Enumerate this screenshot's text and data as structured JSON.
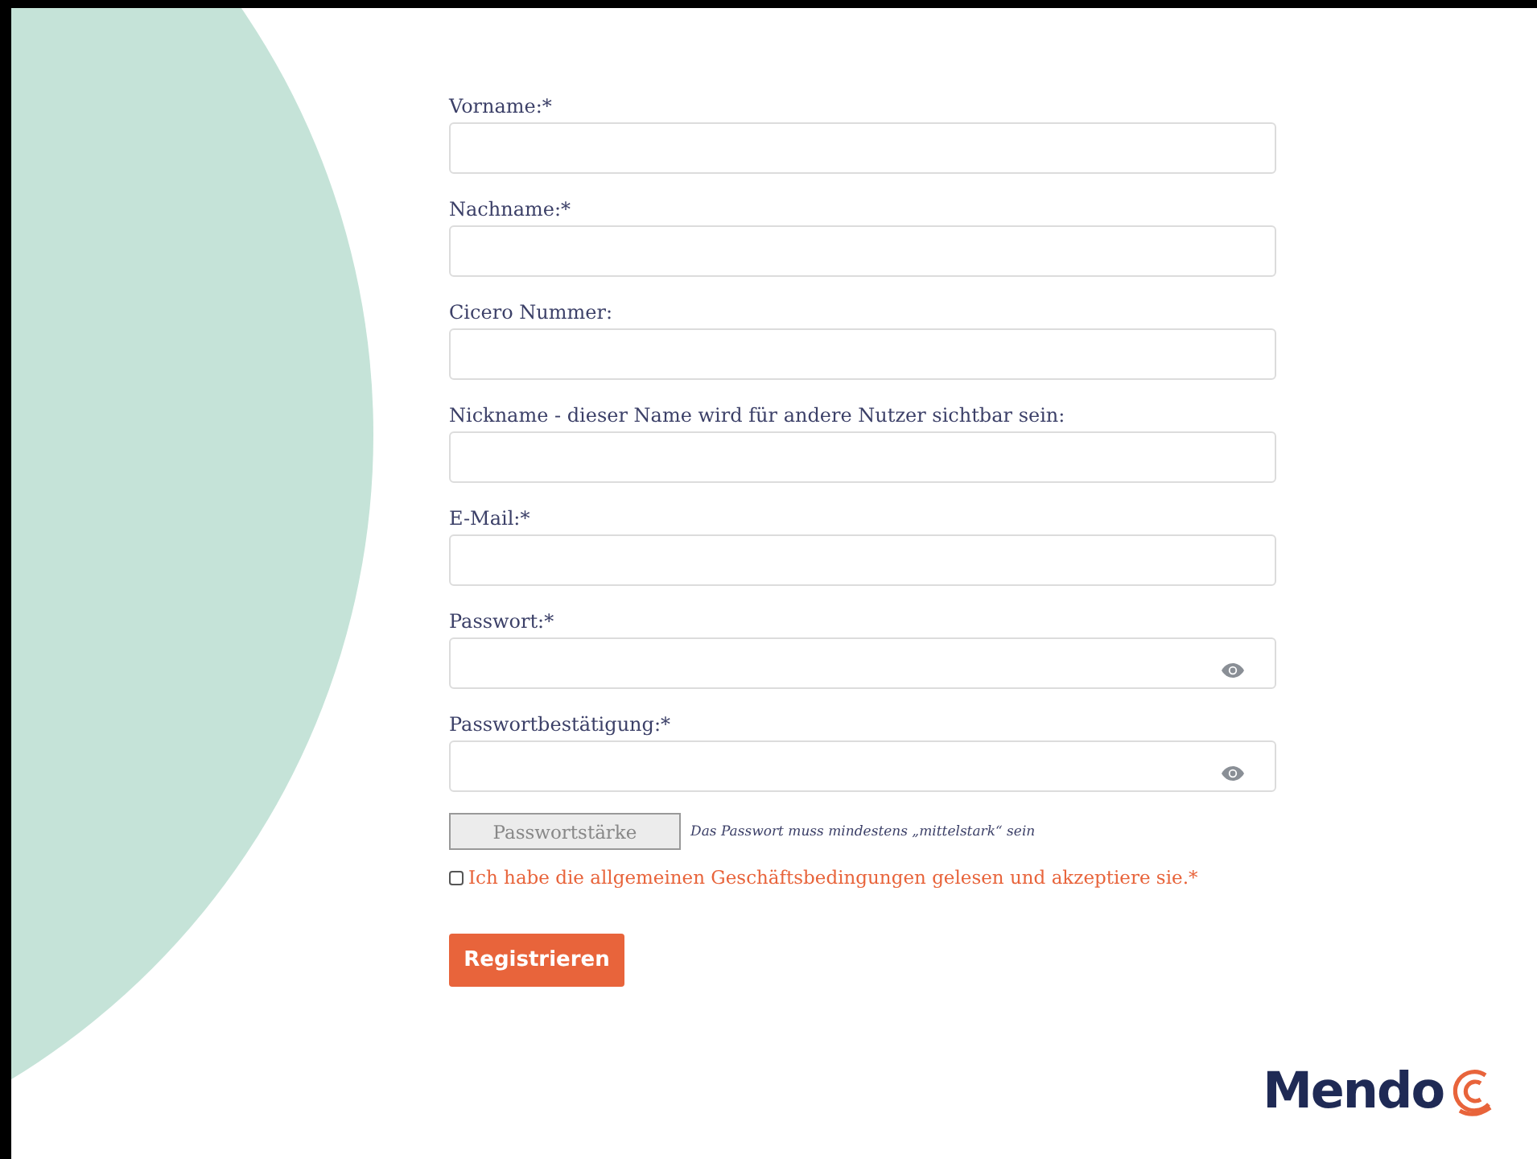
{
  "form": {
    "fields": [
      {
        "label": "Vorname:*",
        "kind": "text"
      },
      {
        "label": "Nachname:*",
        "kind": "text"
      },
      {
        "label": "Cicero Nummer:",
        "kind": "text"
      },
      {
        "label": "Nickname - dieser Name wird für andere Nutzer sichtbar sein:",
        "kind": "text"
      },
      {
        "label": "E-Mail:*",
        "kind": "text"
      },
      {
        "label": "Passwort:*",
        "kind": "password"
      },
      {
        "label": "Passwortbestätigung:*",
        "kind": "password"
      }
    ],
    "strength_button": "Passwortstärke",
    "strength_hint": "Das Passwort muss mindestens „mittelstark“ sein",
    "terms": {
      "label": "Ich habe die allgemeinen Geschäftsbedingungen gelesen und akzeptiere sie.*",
      "checked": false
    },
    "submit": "Registrieren"
  },
  "logo": {
    "text": "Mendo"
  }
}
